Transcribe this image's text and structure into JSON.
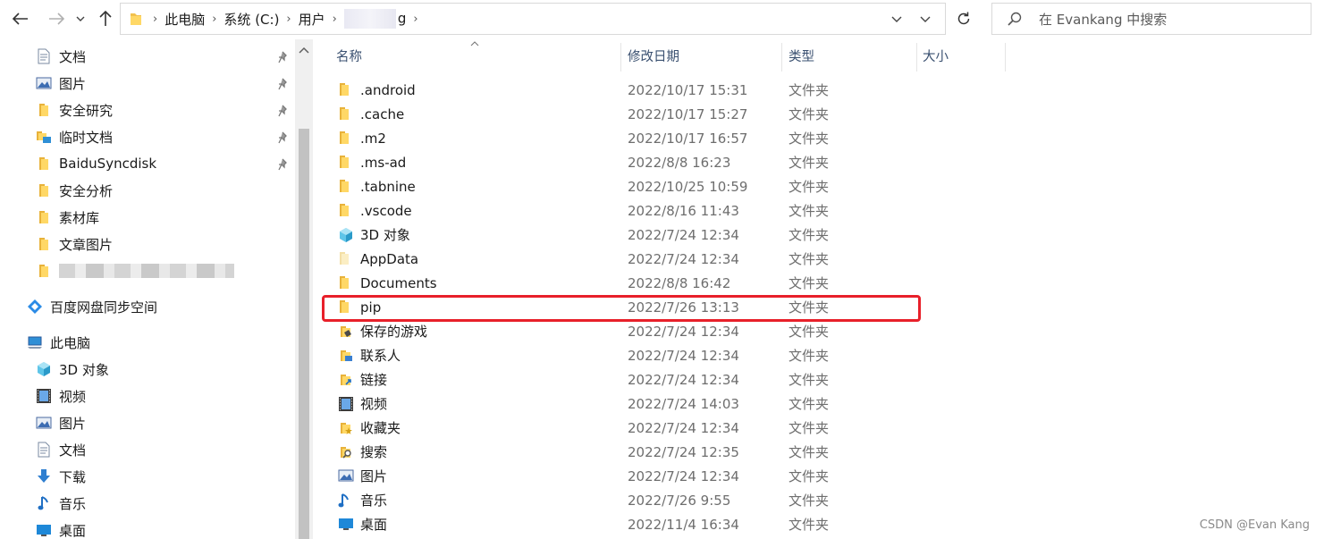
{
  "address_bar": {
    "breadcrumbs": [
      "此电脑",
      "系统 (C:)",
      "用户"
    ],
    "user_folder_suffix": "g"
  },
  "search": {
    "placeholder": "在 Evankang 中搜索"
  },
  "nav": {
    "quick_access": [
      {
        "label": "文档",
        "icon": "document-icon",
        "pinned": true
      },
      {
        "label": "图片",
        "icon": "picture-icon",
        "pinned": true
      },
      {
        "label": "安全研究",
        "icon": "folder-icon",
        "pinned": true
      },
      {
        "label": "临时文档",
        "icon": "network-folder-icon",
        "pinned": true
      },
      {
        "label": "BaiduSyncdisk",
        "icon": "folder-icon",
        "pinned": true
      },
      {
        "label": "安全分析",
        "icon": "folder-icon",
        "pinned": false
      },
      {
        "label": "素材库",
        "icon": "folder-icon",
        "pinned": false
      },
      {
        "label": "文章图片",
        "icon": "folder-icon",
        "pinned": false
      }
    ],
    "baidu": "百度网盘同步空间",
    "this_pc": "此电脑",
    "pc_items": [
      {
        "label": "3D 对象",
        "icon": "3d-objects-icon"
      },
      {
        "label": "视频",
        "icon": "video-icon"
      },
      {
        "label": "图片",
        "icon": "picture-icon"
      },
      {
        "label": "文档",
        "icon": "document-icon"
      },
      {
        "label": "下载",
        "icon": "download-icon"
      },
      {
        "label": "音乐",
        "icon": "music-icon"
      },
      {
        "label": "桌面",
        "icon": "desktop-icon"
      }
    ]
  },
  "columns": {
    "name": "名称",
    "modified": "修改日期",
    "type": "类型",
    "size": "大小"
  },
  "files": [
    {
      "name": ".android",
      "date": "2022/10/17 15:31",
      "type": "文件夹",
      "icon": "folder-icon"
    },
    {
      "name": ".cache",
      "date": "2022/10/17 15:27",
      "type": "文件夹",
      "icon": "folder-icon"
    },
    {
      "name": ".m2",
      "date": "2022/10/17 16:57",
      "type": "文件夹",
      "icon": "folder-icon"
    },
    {
      "name": ".ms-ad",
      "date": "2022/8/8 16:23",
      "type": "文件夹",
      "icon": "folder-icon"
    },
    {
      "name": ".tabnine",
      "date": "2022/10/25 10:59",
      "type": "文件夹",
      "icon": "folder-icon"
    },
    {
      "name": ".vscode",
      "date": "2022/8/16 11:43",
      "type": "文件夹",
      "icon": "folder-icon"
    },
    {
      "name": "3D 对象",
      "date": "2022/7/24 12:34",
      "type": "文件夹",
      "icon": "3d-objects-icon"
    },
    {
      "name": "AppData",
      "date": "2022/7/24 12:34",
      "type": "文件夹",
      "icon": "hidden-folder-icon"
    },
    {
      "name": "Documents",
      "date": "2022/8/8 16:42",
      "type": "文件夹",
      "icon": "folder-icon"
    },
    {
      "name": "pip",
      "date": "2022/7/26 13:13",
      "type": "文件夹",
      "icon": "folder-icon",
      "highlighted": true
    },
    {
      "name": "保存的游戏",
      "date": "2022/7/24 12:34",
      "type": "文件夹",
      "icon": "saved-games-icon"
    },
    {
      "name": "联系人",
      "date": "2022/7/24 12:34",
      "type": "文件夹",
      "icon": "contacts-icon"
    },
    {
      "name": "链接",
      "date": "2022/7/24 12:34",
      "type": "文件夹",
      "icon": "links-icon"
    },
    {
      "name": "视频",
      "date": "2022/7/24 14:03",
      "type": "文件夹",
      "icon": "video-icon"
    },
    {
      "name": "收藏夹",
      "date": "2022/7/24 12:34",
      "type": "文件夹",
      "icon": "favorites-icon"
    },
    {
      "name": "搜索",
      "date": "2022/7/24 12:35",
      "type": "文件夹",
      "icon": "searches-icon"
    },
    {
      "name": "图片",
      "date": "2022/7/24 12:34",
      "type": "文件夹",
      "icon": "picture-icon"
    },
    {
      "name": "音乐",
      "date": "2022/7/26 9:55",
      "type": "文件夹",
      "icon": "music-icon"
    },
    {
      "name": "桌面",
      "date": "2022/11/4 16:34",
      "type": "文件夹",
      "icon": "desktop-icon"
    }
  ],
  "highlight_color": "#e8202a",
  "watermark": "CSDN @Evan Kang"
}
